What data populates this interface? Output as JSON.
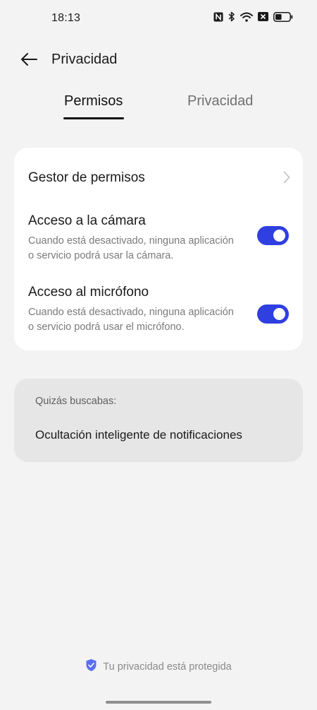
{
  "status_bar": {
    "time": "18:13",
    "icons": [
      "nfc-icon",
      "bluetooth-icon",
      "wifi-icon",
      "no-sim-icon",
      "battery-icon"
    ],
    "battery_level": 0.45
  },
  "header": {
    "title": "Privacidad",
    "back_icon": "arrow-left-icon"
  },
  "tabs": [
    {
      "label": "Permisos",
      "active": true
    },
    {
      "label": "Privacidad",
      "active": false
    }
  ],
  "settings": {
    "permission_manager": {
      "label": "Gestor de permisos",
      "icon": "chevron-right-icon"
    },
    "camera": {
      "label": "Acceso a la cámara",
      "desc_line1": "Cuando está desactivado, ninguna aplicación",
      "desc_line2": "o servicio podrá usar la cámara.",
      "enabled": true
    },
    "microphone": {
      "label": "Acceso al micrófono",
      "desc_line1": "Cuando está desactivado, ninguna aplicación",
      "desc_line2": "o servicio podrá usar el micrófono.",
      "enabled": true
    }
  },
  "suggestion": {
    "label": "Quizás buscabas:",
    "link": "Ocultación inteligente de notificaciones"
  },
  "footer": {
    "text": "Tu privacidad está protegida",
    "icon": "shield-icon"
  },
  "colors": {
    "accent": "#2f3fe0",
    "background": "#f3f3f3",
    "card": "#ffffff",
    "suggest_card": "#e6e6e6",
    "shield": "#5b6df0"
  }
}
